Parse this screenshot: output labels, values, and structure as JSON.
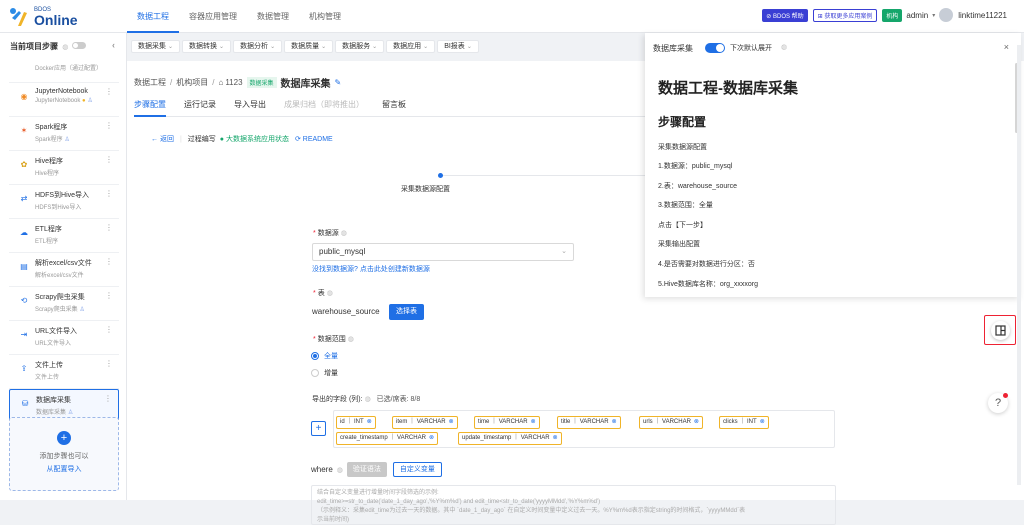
{
  "brand": {
    "small": "BDOS",
    "name": "Online"
  },
  "topnav": [
    "数据工程",
    "容器应用管理",
    "数据管理",
    "机构管理"
  ],
  "header": {
    "help_badge": "BDOS 帮助",
    "cases_badge": "获取更多应用案例",
    "org_badge": "机构",
    "admin": "admin",
    "user": "linktime11221"
  },
  "sidebar": {
    "title": "当前项目步骤",
    "items": [
      {
        "t1": "Docker应用（通过配置）",
        "t2": ""
      },
      {
        "t1": "JupyterNotebook",
        "t2": "JupyterNotebook"
      },
      {
        "t1": "Spark程序",
        "t2": "Spark程序"
      },
      {
        "t1": "Hive程序",
        "t2": "Hive程序"
      },
      {
        "t1": "HDFS到Hive导入",
        "t2": "HDFS到Hive导入"
      },
      {
        "t1": "ETL程序",
        "t2": "ETL程序"
      },
      {
        "t1": "解析excel/csv文件",
        "t2": "解析excel/csv文件"
      },
      {
        "t1": "Scrapy爬虫采集",
        "t2": "Scrapy爬虫采集"
      },
      {
        "t1": "URL文件导入",
        "t2": "URL文件导入"
      },
      {
        "t1": "文件上传",
        "t2": "文件上传"
      },
      {
        "t1": "数据库采集",
        "t2": "数据库采集"
      }
    ],
    "add_line1": "添加步骤也可以",
    "add_line2": "从配置导入"
  },
  "subnav": [
    "数据采集",
    "数据转换",
    "数据分析",
    "数据质量",
    "数据服务",
    "数据应用",
    "BI报表"
  ],
  "breadcrumb": {
    "a": "数据工程",
    "b": "机构项目",
    "c": "1123",
    "tag": "数据采集",
    "title": "数据库采集"
  },
  "tabs": [
    "步骤配置",
    "运行记录",
    "导入导出",
    "成果归档（即将推出）",
    "留言板"
  ],
  "backrow": {
    "back": "← 返回",
    "process": "过程编写",
    "status": "● 大数据系统应用状态",
    "readme": "README"
  },
  "step_label": "采集数据源配置",
  "form": {
    "datasource_label": "数据源",
    "datasource_value": "public_mysql",
    "datasource_link": "没找到数据源? 点击此处创建新数据源",
    "table_label": "表",
    "table_value": "warehouse_source",
    "select_table_btn": "选择表",
    "range_label": "数据范围",
    "range_full": "全量",
    "range_inc": "增量",
    "fields_label": "导出的字段 (列):",
    "fields_count": "已选/席表: 8/8",
    "fields": [
      {
        "name": "id",
        "type": "INT"
      },
      {
        "name": "item",
        "type": "VARCHAR"
      },
      {
        "name": "time",
        "type": "VARCHAR"
      },
      {
        "name": "title",
        "type": "VARCHAR"
      },
      {
        "name": "urls",
        "type": "VARCHAR"
      },
      {
        "name": "clicks",
        "type": "INT"
      },
      {
        "name": "create_timestamp",
        "type": "VARCHAR"
      },
      {
        "name": "update_timestamp",
        "type": "VARCHAR"
      }
    ],
    "where_label": "where",
    "validate_btn": "验证语法",
    "custom_var_btn": "自定义变量",
    "where_hint1": "结合自定义变量进行增量时间字段筛选的示例:",
    "where_hint2": "edit_time>=str_to_date('date_1_day_ago','%Y%m%d') and edit_time<str_to_date('yyyyMMdd','%Y%m%d')",
    "where_hint3": "（示例释义：采集edit_time为过去一天的数据。其中 `date_1_day_ago` 在自定义时间变量中定义过去一天。%Y%m%d表示指定string的时间格式，`yyyyMMdd`表",
    "where_hint4": "示当前时间)"
  },
  "panel": {
    "label": "数据库采集",
    "default_open": "下次默认展开",
    "title": "数据工程-数据库采集",
    "subtitle": "步骤配置",
    "lines": [
      "采集数据源配置",
      "1.数据源：public_mysql",
      "2.表：warehouse_source",
      "3.数据范围：全量",
      "点击【下一步】",
      "采集输出配置",
      "4.是否需要对数据进行分区：否",
      "5.Hive数据库名称：org_xxxxorg"
    ]
  },
  "colors": {
    "accent": "#1f6fe5",
    "success": "#15a66b",
    "chip_border": "#f0b429",
    "highlight": "#e23333"
  }
}
